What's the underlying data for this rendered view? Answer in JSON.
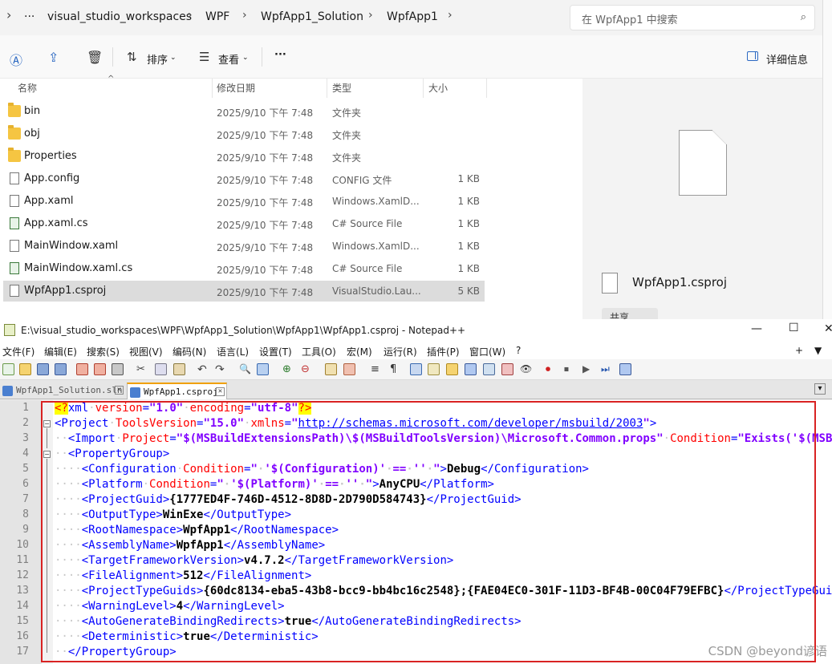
{
  "explorer": {
    "breadcrumbs": [
      "visual_studio_workspaces",
      "WPF",
      "WpfApp1_Solution",
      "WpfApp1"
    ],
    "search_placeholder": "在 WpfApp1 中搜索",
    "commands": {
      "sort": "排序",
      "view": "查看",
      "more": "···",
      "details": "详细信息"
    },
    "columns": {
      "name": "名称",
      "modified": "修改日期",
      "type": "类型",
      "size": "大小"
    },
    "files": [
      {
        "name": "bin",
        "date": "2025/9/10 下午 7:48",
        "type": "文件夹",
        "size": "",
        "kind": "folder"
      },
      {
        "name": "obj",
        "date": "2025/9/10 下午 7:48",
        "type": "文件夹",
        "size": "",
        "kind": "folder"
      },
      {
        "name": "Properties",
        "date": "2025/9/10 下午 7:48",
        "type": "文件夹",
        "size": "",
        "kind": "folder"
      },
      {
        "name": "App.config",
        "date": "2025/9/10 下午 7:48",
        "type": "CONFIG 文件",
        "size": "1 KB",
        "kind": "file"
      },
      {
        "name": "App.xaml",
        "date": "2025/9/10 下午 7:48",
        "type": "Windows.XamlD...",
        "size": "1 KB",
        "kind": "file"
      },
      {
        "name": "App.xaml.cs",
        "date": "2025/9/10 下午 7:48",
        "type": "C# Source File",
        "size": "1 KB",
        "kind": "cs"
      },
      {
        "name": "MainWindow.xaml",
        "date": "2025/9/10 下午 7:48",
        "type": "Windows.XamlD...",
        "size": "1 KB",
        "kind": "file"
      },
      {
        "name": "MainWindow.xaml.cs",
        "date": "2025/9/10 下午 7:48",
        "type": "C# Source File",
        "size": "1 KB",
        "kind": "cs"
      },
      {
        "name": "WpfApp1.csproj",
        "date": "2025/9/10 下午 7:48",
        "type": "VisualStudio.Lau...",
        "size": "5 KB",
        "kind": "file",
        "selected": true
      }
    ],
    "preview": {
      "name": "WpfApp1.csproj",
      "share": "共享"
    }
  },
  "notepad": {
    "title": "E:\\visual_studio_workspaces\\WPF\\WpfApp1_Solution\\WpfApp1\\WpfApp1.csproj - Notepad++",
    "menu": [
      "文件(F)",
      "编辑(E)",
      "搜索(S)",
      "视图(V)",
      "编码(N)",
      "语言(L)",
      "设置(T)",
      "工具(O)",
      "宏(M)",
      "运行(R)",
      "插件(P)",
      "窗口(W)",
      "?"
    ],
    "menu_right": [
      "+",
      "▼"
    ],
    "tabs": [
      {
        "label": "WpfApp1_Solution.sln",
        "active": false
      },
      {
        "label": "WpfApp1.csproj",
        "active": true
      }
    ],
    "line_numbers": [
      "1",
      "2",
      "3",
      "4",
      "5",
      "6",
      "7",
      "8",
      "9",
      "10",
      "11",
      "12",
      "13",
      "14",
      "15",
      "16",
      "17"
    ]
  },
  "watermark": "CSDN @beyond谚语"
}
